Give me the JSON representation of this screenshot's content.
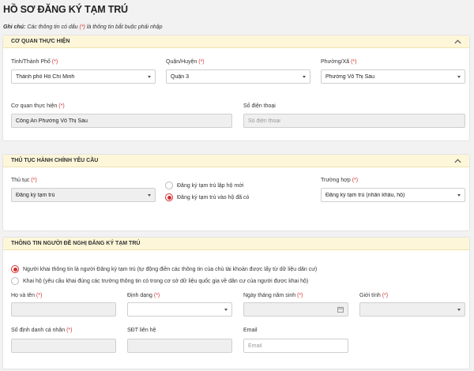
{
  "page": {
    "title": "HỒ SƠ ĐĂNG KÝ TẠM TRÚ",
    "note_label": "Ghi chú:",
    "note_text_before": " Các thông tin có dấu ",
    "note_required_marker": "(*)",
    "note_text_after": " là thông tin bắt buộc phải nhập"
  },
  "agency_section": {
    "title": "CƠ QUAN THỰC HIỆN",
    "province": {
      "label": "Tỉnh/Thành Phố ",
      "required": "(*)",
      "value": "Thành phố Hồ Chí Minh"
    },
    "district": {
      "label": "Quận/Huyện ",
      "required": "(*)",
      "value": "Quận 3"
    },
    "ward": {
      "label": "Phường/Xã ",
      "required": "(*)",
      "value": "Phường Võ Thị Sáu"
    },
    "agency": {
      "label": "Cơ quan thực hiện ",
      "required": "(*)",
      "value": "Công An Phường Võ Thị Sáu"
    },
    "phone": {
      "label": "Số điện thoại",
      "placeholder": "Số điện thoại"
    }
  },
  "procedure_section": {
    "title": "THỦ TỤC HÀNH CHÍNH YÊU CẦU",
    "procedure": {
      "label": "Thủ tục ",
      "required": "(*)",
      "value": "Đăng ký tạm trú"
    },
    "options": [
      {
        "label": "Đăng ký tạm trú lập hộ mới",
        "selected": false
      },
      {
        "label": "Đăng ký tạm trú vào hộ đã có",
        "selected": true
      }
    ],
    "case": {
      "label": "Trường hợp ",
      "required": "(*)",
      "value": "Đăng ký tạm trú (nhân khẩu, hộ)"
    }
  },
  "applicant_section": {
    "title": "THÔNG TIN NGƯỜI ĐỀ NGHỊ ĐĂNG KÝ TẠM TRÚ",
    "options": [
      {
        "label": "Người khai thông tin là người Đăng ký tạm trú (tự động điền các thông tin của chủ tài khoản được lấy từ dữ liệu dân cư)",
        "selected": true
      },
      {
        "label": "Khai hộ (yêu cầu khai đúng các trường thông tin có trong cơ sở dữ liệu quốc gia về dân cư của người được khai hộ)",
        "selected": false
      }
    ],
    "full_name": {
      "label": "Họ và tên ",
      "required": "(*)"
    },
    "format": {
      "label": "Định dạng ",
      "required": "(*)"
    },
    "birth_date": {
      "label": "Ngày tháng năm sinh ",
      "required": "(*)"
    },
    "gender": {
      "label": "Giới tính ",
      "required": "(*)"
    },
    "id_number": {
      "label": "Số định danh cá nhân ",
      "required": "(*)"
    },
    "contact_phone": {
      "label": "SĐT liên hệ"
    },
    "email": {
      "label": "Email",
      "placeholder": "Email"
    }
  },
  "colors": {
    "required": "#d32f2f",
    "section_header": "#fdf6d9",
    "disabled_field": "#efefef"
  },
  "icons": {
    "collapse": "chevron-up-icon",
    "dropdown": "caret-down-icon",
    "date": "calendar-icon"
  }
}
